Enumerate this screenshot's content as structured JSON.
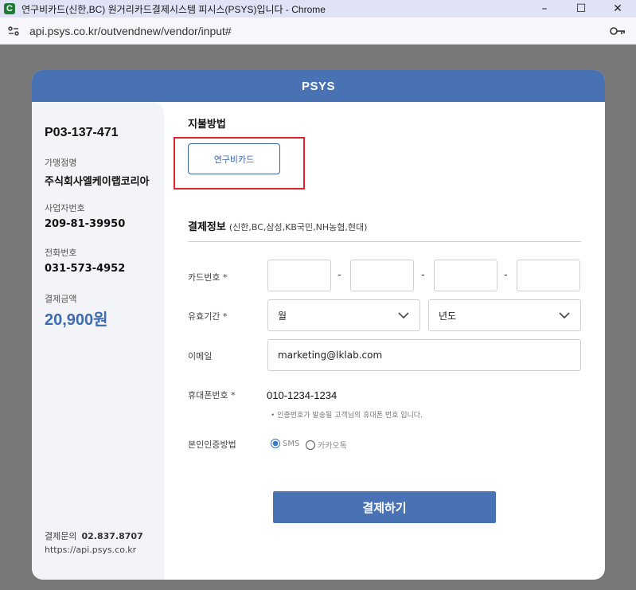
{
  "window": {
    "title": "연구비카드(신한,BC) 원거리카드결제시스템 피시스(PSYS)입니다 - Chrome",
    "app_icon_letter": "C",
    "minimize": "–",
    "maximize": "☐",
    "close": "✕"
  },
  "address_bar": {
    "url": "api.psys.co.kr/outvendnew/vendor/input#"
  },
  "modal": {
    "header_title": "PSYS"
  },
  "sidebar": {
    "order_no": "P03-137-471",
    "merchant_label": "가맹점명",
    "merchant_value": "주식회사엘케이랩코리아",
    "bizno_label": "사업자번호",
    "bizno_value": "209-81-39950",
    "tel_label": "전화번호",
    "tel_value": "031-573-4952",
    "amount_label": "결제금액",
    "amount_value": "20,900원",
    "contact_label": "결제문의",
    "contact_phone": "02.837.8707",
    "site_url": "https://api.psys.co.kr"
  },
  "main": {
    "payment_method_title": "지불방법",
    "payment_method_option": "연구비카드",
    "payment_info_title": "결제정보",
    "payment_info_sub": "(신한,BC,삼성,KB국민,NH농협,현대)",
    "card_number_label": "카드번호 *",
    "card_dash": "-",
    "expiry_label": "유효기간 *",
    "month_select": "월",
    "year_select": "년도",
    "email_label": "이메일",
    "email_value": "marketing@lklab.com",
    "phone_label": "휴대폰번호 *",
    "phone_value": "010-1234-1234",
    "phone_note": "• 인증번호가 발송될 고객님의 휴대폰 번호 입니다.",
    "auth_label": "본인인증방법",
    "auth_options": [
      {
        "label": "SMS",
        "selected": true
      },
      {
        "label": "카카오톡",
        "selected": false
      }
    ],
    "submit_label": "결제하기"
  },
  "colors": {
    "brand_blue": "#4872b4",
    "highlight_red": "#e0232b",
    "amount_blue": "#3e6cb0",
    "overlay_gray": "#787878"
  }
}
